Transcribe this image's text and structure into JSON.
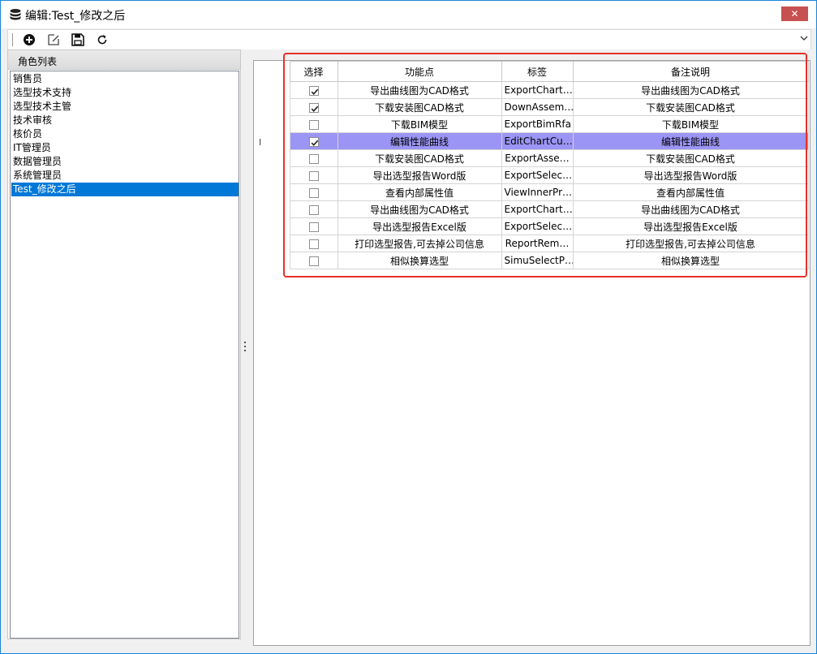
{
  "window": {
    "title": "编辑:Test_修改之后",
    "close_label": "✕",
    "title_icon": "database-icon"
  },
  "toolbar": {
    "buttons": [
      {
        "name": "add-button",
        "icon": "plus-circle-icon"
      },
      {
        "name": "edit-button",
        "icon": "edit-icon"
      },
      {
        "name": "save-button",
        "icon": "floppy-disk-icon"
      },
      {
        "name": "refresh-button",
        "icon": "refresh-icon"
      }
    ],
    "overflow_icon": "chevron-down-icon"
  },
  "role_list": {
    "header": "角色列表",
    "items": [
      "销售员",
      "选型技术支持",
      "选型技术主管",
      "技术审核",
      "核价员",
      "IT管理员",
      "数据管理员",
      "系统管理员",
      "Test_修改之后"
    ],
    "selected_index": 8
  },
  "grid": {
    "columns": [
      "选择",
      "功能点",
      "标签",
      "备注说明"
    ],
    "rows": [
      {
        "checked": true,
        "feature": "导出曲线图为CAD格式",
        "tag": "ExportChart…",
        "note": "导出曲线图为CAD格式"
      },
      {
        "checked": true,
        "feature": "下载安装图CAD格式",
        "tag": "DownAssem…",
        "note": "下载安装图CAD格式"
      },
      {
        "checked": false,
        "feature": "下载BIM模型",
        "tag": "ExportBimRfa",
        "note": "下载BIM模型"
      },
      {
        "checked": true,
        "feature": "编辑性能曲线",
        "tag": "EditChartCu…",
        "note": "编辑性能曲线",
        "selected": true
      },
      {
        "checked": false,
        "feature": "下载安装图CAD格式",
        "tag": "ExportAsse…",
        "note": "下载安装图CAD格式"
      },
      {
        "checked": false,
        "feature": "导出选型报告Word版",
        "tag": "ExportSelec…",
        "note": "导出选型报告Word版"
      },
      {
        "checked": false,
        "feature": "查看内部属性值",
        "tag": "ViewInnerPr…",
        "note": "查看内部属性值"
      },
      {
        "checked": false,
        "feature": "导出曲线图为CAD格式",
        "tag": "ExportChart…",
        "note": "导出曲线图为CAD格式"
      },
      {
        "checked": false,
        "feature": "导出选型报告Excel版",
        "tag": "ExportSelec…",
        "note": "导出选型报告Excel版"
      },
      {
        "checked": false,
        "feature": "打印选型报告,可去掉公司信息",
        "tag": "ReportRem…",
        "note": "打印选型报告,可去掉公司信息"
      },
      {
        "checked": false,
        "feature": "相似换算选型",
        "tag": "SimuSelectP…",
        "note": "相似换算选型"
      }
    ],
    "selection_color": "#9b95f5",
    "highlight_color": "#e8302a"
  }
}
